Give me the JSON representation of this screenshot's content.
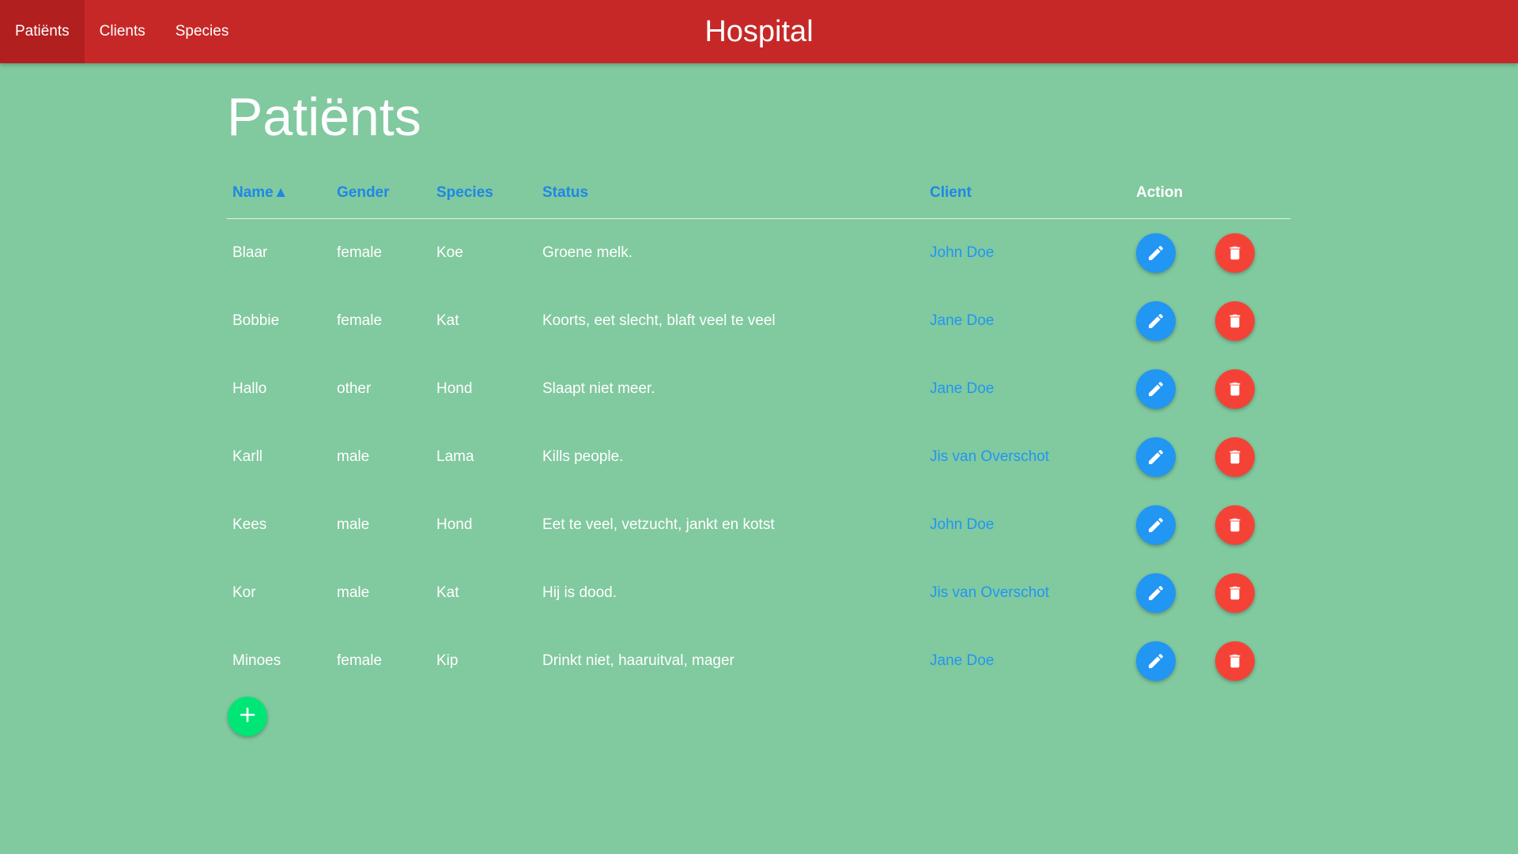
{
  "nav": {
    "brand": "Hospital",
    "links": [
      {
        "label": "Patiënts",
        "active": true
      },
      {
        "label": "Clients",
        "active": false
      },
      {
        "label": "Species",
        "active": false
      }
    ]
  },
  "page": {
    "title": "Patiënts"
  },
  "table": {
    "headers": {
      "name": "Name▲",
      "gender": "Gender",
      "species": "Species",
      "status": "Status",
      "client": "Client",
      "action": "Action"
    },
    "sort": {
      "column": "name",
      "direction": "ascending"
    },
    "rows": [
      {
        "name": "Blaar",
        "gender": "female",
        "species": "Koe",
        "status": "Groene melk.",
        "client": "John Doe"
      },
      {
        "name": "Bobbie",
        "gender": "female",
        "species": "Kat",
        "status": "Koorts, eet slecht, blaft veel te veel",
        "client": "Jane Doe"
      },
      {
        "name": "Hallo",
        "gender": "other",
        "species": "Hond",
        "status": "Slaapt niet meer.",
        "client": "Jane Doe"
      },
      {
        "name": "Karll",
        "gender": "male",
        "species": "Lama",
        "status": "Kills people.",
        "client": "Jis van Overschot"
      },
      {
        "name": "Kees",
        "gender": "male",
        "species": "Hond",
        "status": "Eet te veel, vetzucht, jankt en kotst",
        "client": "John Doe"
      },
      {
        "name": "Kor",
        "gender": "male",
        "species": "Kat",
        "status": "Hij is dood.",
        "client": "Jis van Overschot"
      },
      {
        "name": "Minoes",
        "gender": "female",
        "species": "Kip",
        "status": "Drinkt niet, haaruitval, mager",
        "client": "Jane Doe"
      }
    ],
    "row_actions": [
      {
        "icon": "pencil-icon",
        "color": "#2196f3"
      },
      {
        "icon": "trash-icon",
        "color": "#f44336"
      }
    ]
  },
  "add_button": {
    "icon": "plus-icon",
    "color": "#00e676"
  },
  "colors": {
    "background": "#81c99f",
    "navbar": "#c62828",
    "link": "#2196f3"
  }
}
